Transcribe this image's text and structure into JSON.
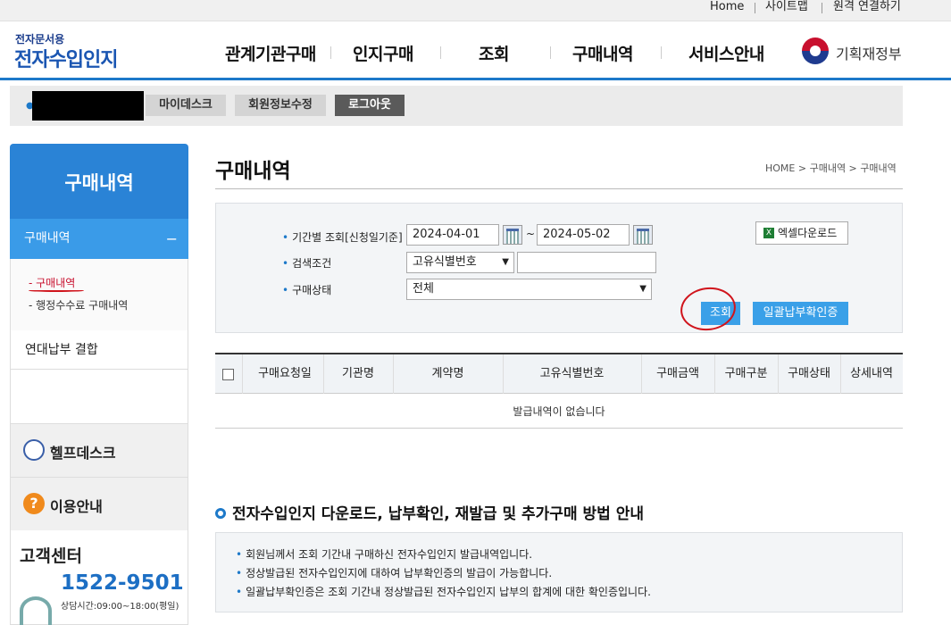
{
  "topbar": {
    "home": "Home",
    "sitemap": "사이트맵",
    "remote": "원격 연결하기"
  },
  "header": {
    "logo_small": "전자문서용",
    "logo_big": "전자수입인지",
    "nav": [
      "관계기관구매",
      "인지구매",
      "조회",
      "구매내역",
      "서비스안내"
    ],
    "ministry": "기획재정부"
  },
  "userbar": {
    "mydisk": "마이데스크",
    "edit_info": "회원정보수정",
    "logout": "로그아웃"
  },
  "sidebar": {
    "title": "구매내역",
    "selected": "구매내역",
    "selected_toggle": "−",
    "sub_items": [
      "- 구매내역",
      "- 행정수수료 구매내역"
    ],
    "joint": "연대납부 결합",
    "helpdesk": "헬프데스크",
    "guide": "이용안내",
    "cs_title": "고객센터",
    "cs_phone": "1522-9501",
    "cs_hours": "상담시간:09:00~18:00(평일)"
  },
  "main": {
    "title": "구매내역",
    "breadcrumb": "HOME > 구매내역 > 구매내역",
    "search": {
      "period_label": "기간별 조회[신청일기준]",
      "date_from": "2024-04-01",
      "tilde": "~",
      "date_to": "2024-05-02",
      "condition_label": "검색조건",
      "condition_value": "고유식별번호",
      "condition_input": "",
      "status_label": "구매상태",
      "status_value": "전체",
      "excel": "엑셀다운로드",
      "search_btn": "조회",
      "bulk_btn": "일괄납부확인증"
    },
    "table": {
      "headers": [
        "구매요청일",
        "기관명",
        "계약명",
        "고유식별번호",
        "구매금액",
        "구매구분",
        "구매상태",
        "상세내역"
      ],
      "empty": "발급내역이 없습니다"
    },
    "guide": {
      "title": "전자수입인지 다운로드, 납부확인, 재발급 및 추가구매 방법 안내",
      "lines": [
        "회원님께서 조회 기간내 구매하신 전자수입인지 발급내역입니다.",
        "정상발급된 전자수입인지에 대하여 납부확인증의 발급이 가능합니다.",
        "일괄납부확인증은 조회 기간내 정상발급된 전자수입인지 납부의 합계에 대한 확인증입니다."
      ]
    }
  },
  "colors": {
    "accent": "#1d79c9",
    "sidebar_head": "#2a83d6",
    "button": "#3aa0e8",
    "annotation": "#d0141c"
  }
}
